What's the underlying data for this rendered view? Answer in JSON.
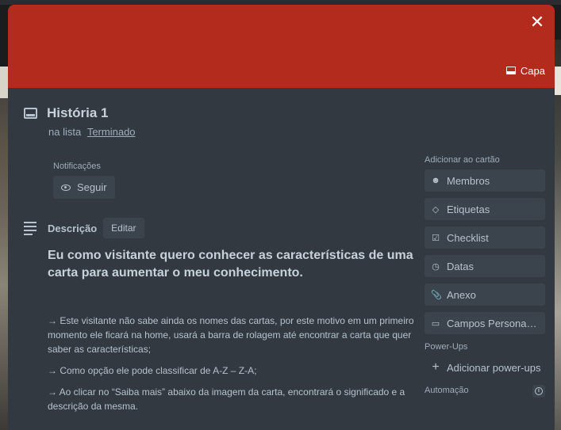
{
  "cover": {
    "button_label": "Capa",
    "color": "#b22b1c"
  },
  "close_glyph": "✕",
  "card": {
    "title": "História 1",
    "in_list_prefix": "na lista",
    "list_name": "Terminado"
  },
  "notifications": {
    "label": "Notificações",
    "follow_label": "Seguir"
  },
  "description": {
    "title": "Descrição",
    "edit_label": "Editar",
    "heading": "Eu como visitante quero conhecer as características de uma carta para aumentar o meu conhecimento.",
    "paragraphs": [
      "→ Este visitante não sabe ainda os nomes das cartas, por este motivo em um primeiro momento ele ficará na home, usará a barra de rolagem até encontrar a carta que quer saber as características;",
      "→ Como opção ele pode classificar de A-Z – Z-A;",
      "→ Ao clicar no “Saiba mais” abaixo da imagem da carta, encontrará o significado e a descrição da mesma."
    ]
  },
  "sidebar": {
    "add_to_card_label": "Adicionar ao cartão",
    "buttons": [
      {
        "label": "Membros",
        "icon": "person-icon"
      },
      {
        "label": "Etiquetas",
        "icon": "tag-icon"
      },
      {
        "label": "Checklist",
        "icon": "checklist-icon"
      },
      {
        "label": "Datas",
        "icon": "clock-icon"
      },
      {
        "label": "Anexo",
        "icon": "paperclip-icon"
      },
      {
        "label": "Campos Personalizados",
        "icon": "custom-fields-icon"
      }
    ],
    "powerups_label": "Power-Ups",
    "add_powerup_label": "Adicionar power-ups",
    "automation_label": "Automação"
  }
}
